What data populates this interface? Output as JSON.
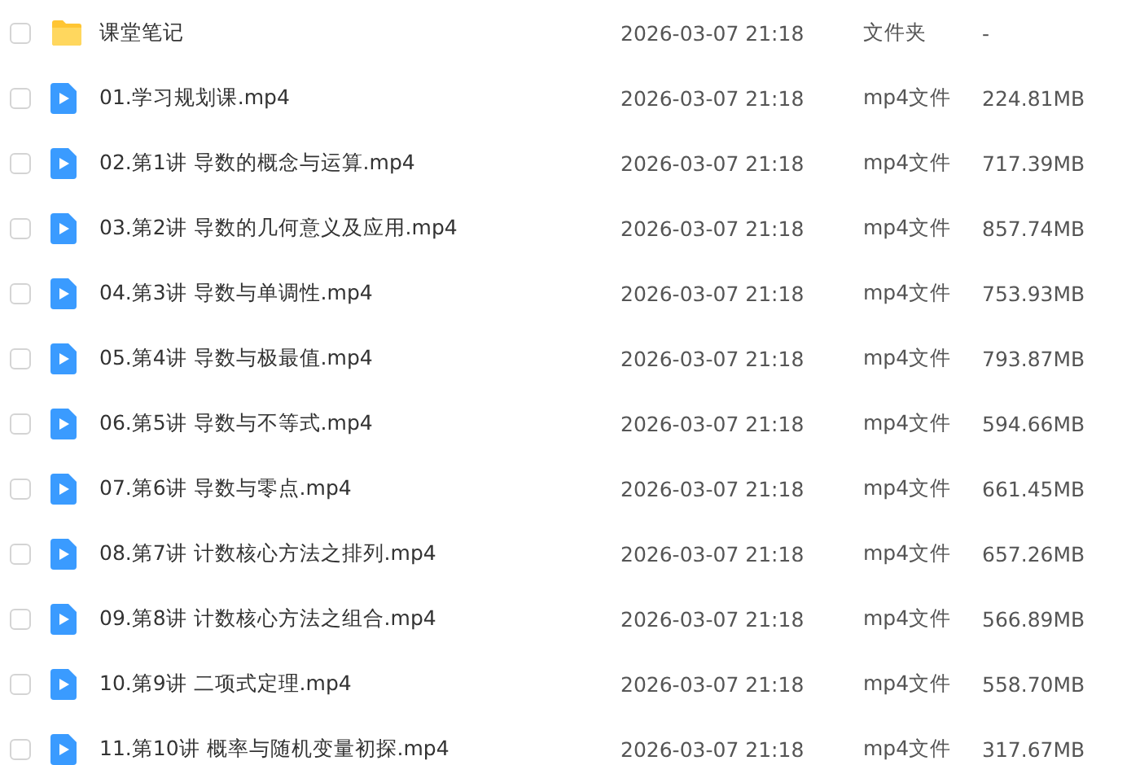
{
  "files": [
    {
      "kind": "folder",
      "checked": false,
      "name": "课堂笔记",
      "modified": "2026-03-07 21:18",
      "type": "文件夹",
      "size": "-"
    },
    {
      "kind": "video",
      "checked": false,
      "name": "01.学习规划课.mp4",
      "modified": "2026-03-07 21:18",
      "type": "mp4文件",
      "size": "224.81MB"
    },
    {
      "kind": "video",
      "checked": false,
      "name": "02.第1讲 导数的概念与运算.mp4",
      "modified": "2026-03-07 21:18",
      "type": "mp4文件",
      "size": "717.39MB"
    },
    {
      "kind": "video",
      "checked": false,
      "name": "03.第2讲 导数的几何意义及应用.mp4",
      "modified": "2026-03-07 21:18",
      "type": "mp4文件",
      "size": "857.74MB"
    },
    {
      "kind": "video",
      "checked": false,
      "name": "04.第3讲 导数与单调性.mp4",
      "modified": "2026-03-07 21:18",
      "type": "mp4文件",
      "size": "753.93MB"
    },
    {
      "kind": "video",
      "checked": false,
      "name": "05.第4讲 导数与极最值.mp4",
      "modified": "2026-03-07 21:18",
      "type": "mp4文件",
      "size": "793.87MB"
    },
    {
      "kind": "video",
      "checked": false,
      "name": "06.第5讲 导数与不等式.mp4",
      "modified": "2026-03-07 21:18",
      "type": "mp4文件",
      "size": "594.66MB"
    },
    {
      "kind": "video",
      "checked": false,
      "name": "07.第6讲 导数与零点.mp4",
      "modified": "2026-03-07 21:18",
      "type": "mp4文件",
      "size": "661.45MB"
    },
    {
      "kind": "video",
      "checked": false,
      "name": "08.第7讲 计数核心方法之排列.mp4",
      "modified": "2026-03-07 21:18",
      "type": "mp4文件",
      "size": "657.26MB"
    },
    {
      "kind": "video",
      "checked": false,
      "name": "09.第8讲 计数核心方法之组合.mp4",
      "modified": "2026-03-07 21:18",
      "type": "mp4文件",
      "size": "566.89MB"
    },
    {
      "kind": "video",
      "checked": false,
      "name": "10.第9讲 二项式定理.mp4",
      "modified": "2026-03-07 21:18",
      "type": "mp4文件",
      "size": "558.70MB"
    },
    {
      "kind": "video",
      "checked": false,
      "name": "11.第10讲 概率与随机变量初探.mp4",
      "modified": "2026-03-07 21:18",
      "type": "mp4文件",
      "size": "317.67MB"
    }
  ]
}
